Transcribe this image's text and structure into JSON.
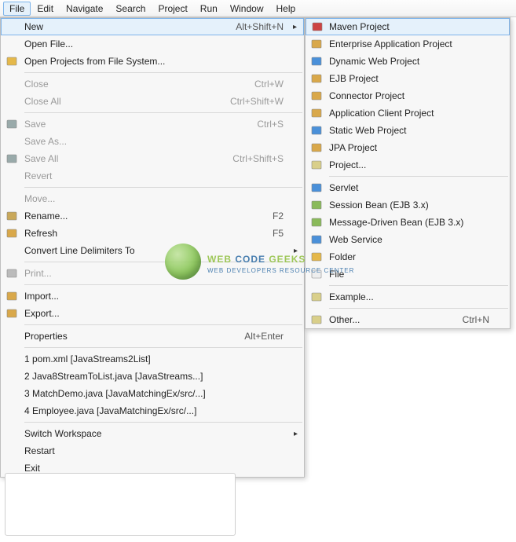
{
  "menubar": {
    "items": [
      "File",
      "Edit",
      "Navigate",
      "Search",
      "Project",
      "Run",
      "Window",
      "Help"
    ],
    "active_index": 0
  },
  "file_menu": {
    "groups": [
      [
        {
          "label": "New",
          "accel": "Alt+Shift+N",
          "submenu": true,
          "icon": null,
          "disabled": false,
          "highlight": true
        },
        {
          "label": "Open File...",
          "icon": null
        },
        {
          "label": "Open Projects from File System...",
          "icon": "folder-open-icon"
        }
      ],
      [
        {
          "label": "Close",
          "accel": "Ctrl+W",
          "disabled": true
        },
        {
          "label": "Close All",
          "accel": "Ctrl+Shift+W",
          "disabled": true
        }
      ],
      [
        {
          "label": "Save",
          "accel": "Ctrl+S",
          "icon": "save-icon",
          "disabled": true
        },
        {
          "label": "Save As...",
          "disabled": true
        },
        {
          "label": "Save All",
          "accel": "Ctrl+Shift+S",
          "icon": "save-all-icon",
          "disabled": true
        },
        {
          "label": "Revert",
          "disabled": true
        }
      ],
      [
        {
          "label": "Move...",
          "disabled": true
        },
        {
          "label": "Rename...",
          "accel": "F2",
          "icon": "rename-icon"
        },
        {
          "label": "Refresh",
          "accel": "F5",
          "icon": "refresh-icon"
        },
        {
          "label": "Convert Line Delimiters To",
          "submenu": true
        }
      ],
      [
        {
          "label": "Print...",
          "disabled": true,
          "icon": "print-icon"
        }
      ],
      [
        {
          "label": "Import...",
          "icon": "import-icon"
        },
        {
          "label": "Export...",
          "icon": "export-icon"
        }
      ],
      [
        {
          "label": "Properties",
          "accel": "Alt+Enter"
        }
      ],
      [
        {
          "label": "1 pom.xml  [JavaStreams2List]"
        },
        {
          "label": "2 Java8StreamToList.java  [JavaStreams...]"
        },
        {
          "label": "3 MatchDemo.java  [JavaMatchingEx/src/...]"
        },
        {
          "label": "4 Employee.java  [JavaMatchingEx/src/...]"
        }
      ],
      [
        {
          "label": "Switch Workspace",
          "submenu": true
        },
        {
          "label": "Restart"
        },
        {
          "label": "Exit"
        }
      ]
    ]
  },
  "new_menu": {
    "groups": [
      [
        {
          "label": "Maven Project",
          "icon": "maven-icon",
          "highlight": true
        },
        {
          "label": "Enterprise Application Project",
          "icon": "ear-project-icon"
        },
        {
          "label": "Dynamic Web Project",
          "icon": "web-project-icon"
        },
        {
          "label": "EJB Project",
          "icon": "ejb-project-icon"
        },
        {
          "label": "Connector Project",
          "icon": "connector-project-icon"
        },
        {
          "label": "Application Client Project",
          "icon": "appclient-project-icon"
        },
        {
          "label": "Static Web Project",
          "icon": "static-web-icon"
        },
        {
          "label": "JPA Project",
          "icon": "jpa-project-icon"
        },
        {
          "label": "Project...",
          "icon": "project-icon"
        }
      ],
      [
        {
          "label": "Servlet",
          "icon": "servlet-icon"
        },
        {
          "label": "Session Bean (EJB 3.x)",
          "icon": "session-bean-icon"
        },
        {
          "label": "Message-Driven Bean (EJB 3.x)",
          "icon": "mdb-icon"
        },
        {
          "label": "Web Service",
          "icon": "webservice-icon"
        },
        {
          "label": "Folder",
          "icon": "folder-icon"
        },
        {
          "label": "File",
          "icon": "file-icon"
        }
      ],
      [
        {
          "label": "Example...",
          "icon": "example-icon"
        }
      ],
      [
        {
          "label": "Other...",
          "accel": "Ctrl+N",
          "icon": "other-icon"
        }
      ]
    ]
  },
  "watermark": {
    "line1_a": "WEB ",
    "line1_b": "CODE",
    "line1_c": " GEEKS",
    "line2": "WEB DEVELOPERS RESOURCE CENTER"
  }
}
